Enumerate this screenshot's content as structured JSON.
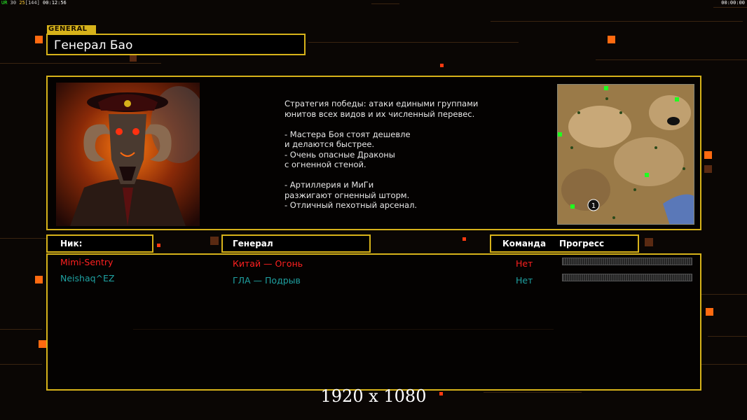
{
  "topbar": {
    "fps_a": "UR",
    "fps_b": "30",
    "fps_c": "25",
    "fps_d": "[144]",
    "time_left": "00:12:56",
    "time_right": "00:00:00"
  },
  "general": {
    "tag": "GENERAL",
    "name": "Генерал Бао",
    "portrait_icon": "demon-general-portrait",
    "description": "Стратегия победы: атаки едиными группами\nюнитов всех видов и их численный перевес.\n\n- Мастера Боя стоят дешевле\nи делаются быстрее.\n- Очень опасные Драконы\nс огненной стеной.\n\n- Артиллерия и МиГи\nразжигают огненный шторм.\n- Отличный пехотный арсенал."
  },
  "minimap": {
    "icon": "desert-minimap",
    "start_marker": "1"
  },
  "headers": {
    "nick": "Ник:",
    "general": "Генерал",
    "team": "Команда",
    "progress": "Прогресс"
  },
  "players": [
    {
      "nick": "Mimi-Sentry",
      "general": "Китай — Огонь",
      "team": "Нет",
      "color": "#ff2020"
    },
    {
      "nick": "Neishaq^EZ",
      "general": "ГЛА — Подрыв",
      "team": "Нет",
      "color": "#1fa2a2"
    }
  ],
  "resolution_text": "1920 x 1080",
  "colors": {
    "accent_gold": "#d6b21a",
    "accent_orange": "#ff6a10"
  }
}
